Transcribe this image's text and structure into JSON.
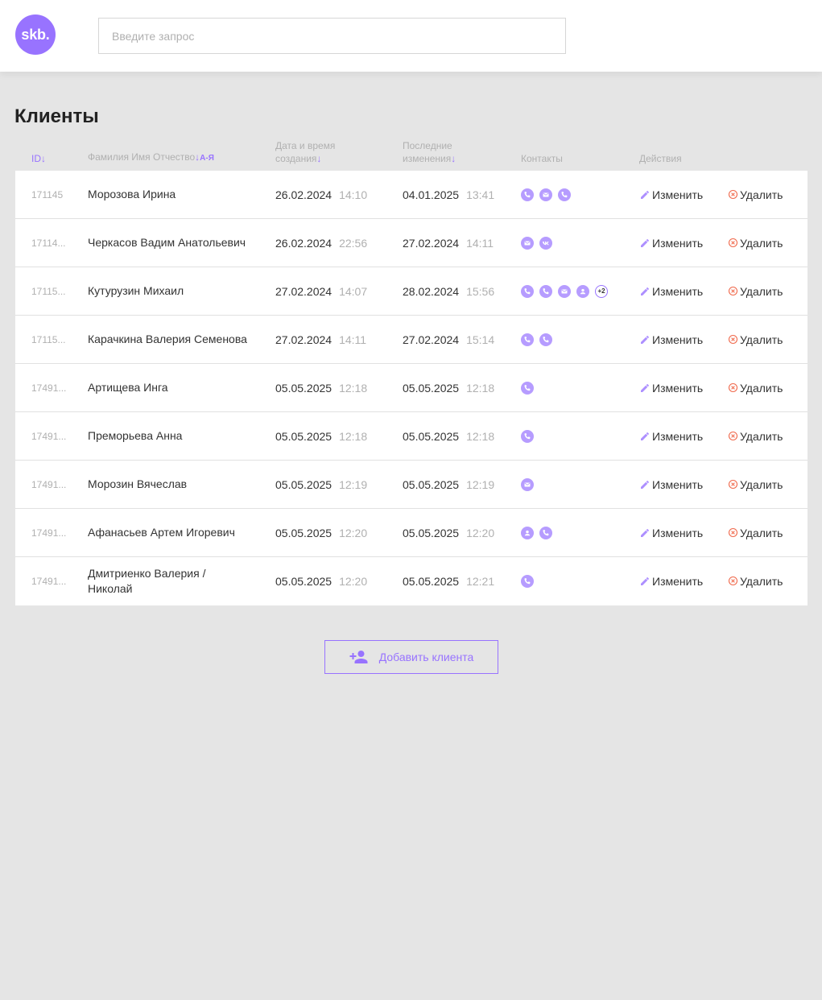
{
  "header": {
    "logo_text": "skb.",
    "search_placeholder": "Введите запрос"
  },
  "page_title": "Клиенты",
  "columns": {
    "id": "ID",
    "name": "Фамилия Имя Отчество",
    "name_sort": "А-Я",
    "created_l1": "Дата и время",
    "created_l2": "создания",
    "changed_l1": "Последние",
    "changed_l2": "изменения",
    "contacts": "Контакты",
    "actions": "Действия",
    "sort_arrow": "↓"
  },
  "actions": {
    "edit_label": "Изменить",
    "delete_label": "Удалить"
  },
  "clients": [
    {
      "id": "171145",
      "name": "Морозова Ирина",
      "created_date": "26.02.2024",
      "created_time": "14:10",
      "changed_date": "04.01.2025",
      "changed_time": "13:41",
      "contacts": [
        "phone-icon",
        "mail-icon",
        "phone-icon"
      ],
      "more": ""
    },
    {
      "id": "17114...",
      "name": "Черкасов Вадим Анатольевич",
      "created_date": "26.02.2024",
      "created_time": "22:56",
      "changed_date": "27.02.2024",
      "changed_time": "14:11",
      "contacts": [
        "mail-icon",
        "vk-icon"
      ],
      "more": ""
    },
    {
      "id": "17115...",
      "name": "Кутурузин Михаил",
      "created_date": "27.02.2024",
      "created_time": "14:07",
      "changed_date": "28.02.2024",
      "changed_time": "15:56",
      "contacts": [
        "phone-icon",
        "phone-icon",
        "mail-icon",
        "user-icon"
      ],
      "more": "+2"
    },
    {
      "id": "17115...",
      "name": "Карачкина Валерия Семенова",
      "created_date": "27.02.2024",
      "created_time": "14:11",
      "changed_date": "27.02.2024",
      "changed_time": "15:14",
      "contacts": [
        "phone-icon",
        "phone-icon"
      ],
      "more": ""
    },
    {
      "id": "17491...",
      "name": "Артищева Инга",
      "created_date": "05.05.2025",
      "created_time": "12:18",
      "changed_date": "05.05.2025",
      "changed_time": "12:18",
      "contacts": [
        "phone-icon"
      ],
      "more": ""
    },
    {
      "id": "17491...",
      "name": "Преморьева Анна",
      "created_date": "05.05.2025",
      "created_time": "12:18",
      "changed_date": "05.05.2025",
      "changed_time": "12:18",
      "contacts": [
        "phone-icon"
      ],
      "more": ""
    },
    {
      "id": "17491...",
      "name": "Морозин Вячеслав",
      "created_date": "05.05.2025",
      "created_time": "12:19",
      "changed_date": "05.05.2025",
      "changed_time": "12:19",
      "contacts": [
        "mail-icon"
      ],
      "more": ""
    },
    {
      "id": "17491...",
      "name": "Афанасьев Артем Игоревич",
      "created_date": "05.05.2025",
      "created_time": "12:20",
      "changed_date": "05.05.2025",
      "changed_time": "12:20",
      "contacts": [
        "user-icon",
        "phone-icon"
      ],
      "more": ""
    },
    {
      "id": "17491...",
      "name": "Дмитриенко Валерия / Николай",
      "created_date": "05.05.2025",
      "created_time": "12:20",
      "changed_date": "05.05.2025",
      "changed_time": "12:21",
      "contacts": [
        "phone-icon"
      ],
      "more": ""
    }
  ],
  "add_button_label": "Добавить клиента",
  "colors": {
    "accent": "#9873ff",
    "delete": "#f06a4d",
    "background": "#e5e5e5"
  }
}
